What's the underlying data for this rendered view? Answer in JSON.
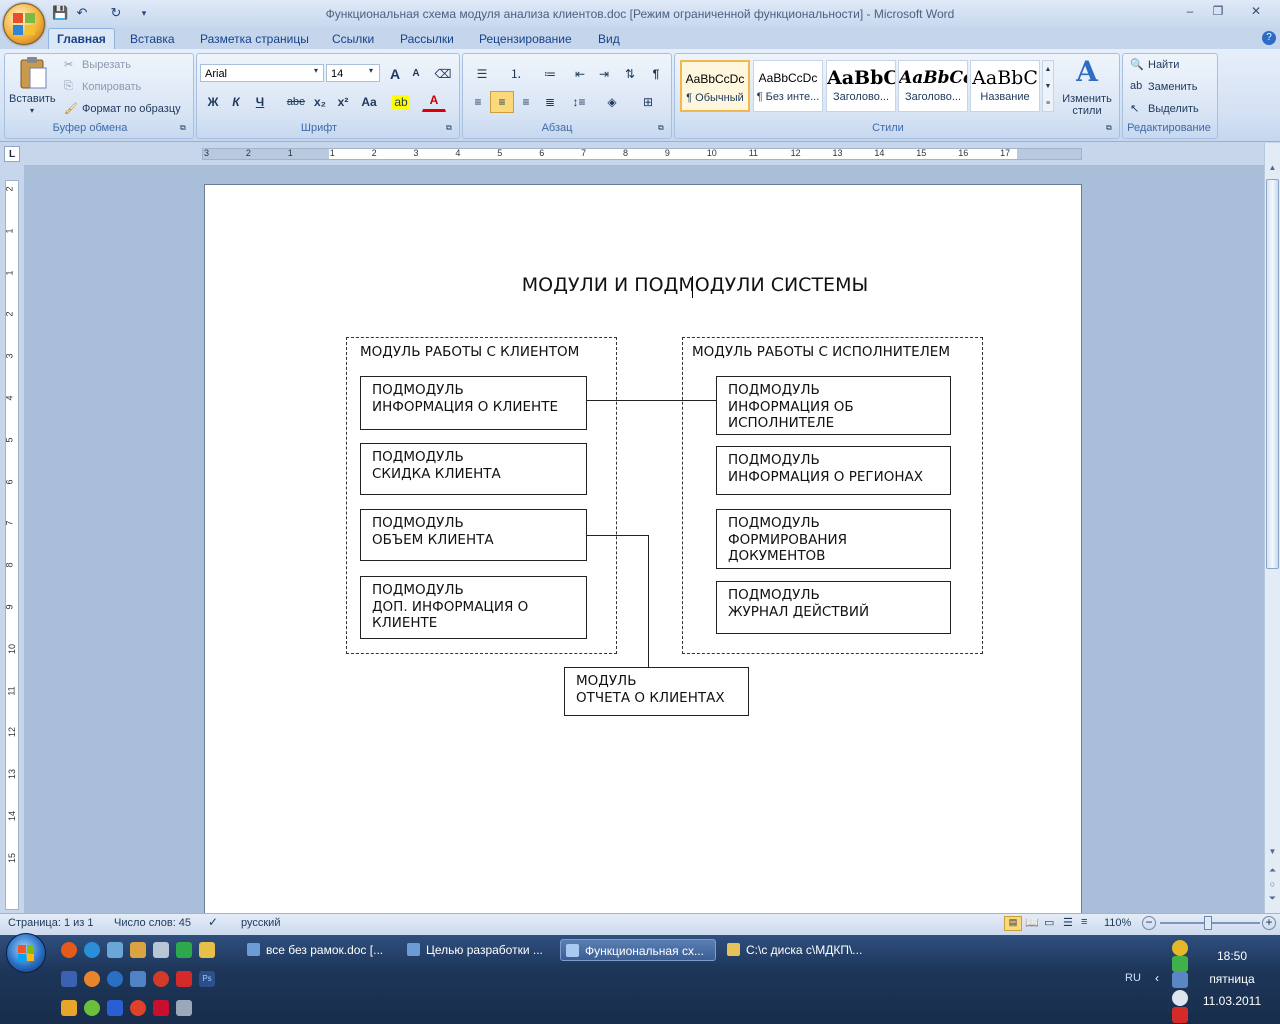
{
  "window": {
    "title": "Функциональная схема модуля анализа клиентов.doc [Режим ограниченной функциональности] - Microsoft Word",
    "controls": [
      "–",
      "❐",
      "✕"
    ]
  },
  "tabs": [
    "Главная",
    "Вставка",
    "Разметка страницы",
    "Ссылки",
    "Рассылки",
    "Рецензирование",
    "Вид"
  ],
  "ribbon": {
    "clipboard": {
      "paste": "Вставить",
      "cut": "Вырезать",
      "copy": "Копировать",
      "format_painter": "Формат по образцу",
      "label": "Буфер обмена"
    },
    "font": {
      "name": "Arial",
      "size": "14",
      "label": "Шрифт",
      "bold": "Ж",
      "italic": "К",
      "underline": "Ч",
      "strike": "abe",
      "sub": "x₂",
      "sup": "x²",
      "case": "Aa",
      "grow": "A",
      "shrink": "A",
      "color_letter": "A"
    },
    "paragraph": {
      "label": "Абзац",
      "pilcrow": "¶"
    },
    "styles": {
      "label": "Стили",
      "items": [
        {
          "preview": "AaBbCcDc",
          "name": "¶ Обычный"
        },
        {
          "preview": "AaBbCcDc",
          "name": "¶ Без инте..."
        },
        {
          "preview": "AaBbC",
          "name": "Заголово..."
        },
        {
          "preview": "AaBbCc",
          "name": "Заголово..."
        },
        {
          "preview": "AaBbC",
          "name": "Название"
        }
      ],
      "change_styles": "Изменить стили"
    },
    "editing": {
      "label": "Редактирование",
      "find": "Найти",
      "replace": "Заменить",
      "select": "Выделить"
    }
  },
  "ruler_numbers": [
    "3",
    "2",
    "1",
    "1",
    "2",
    "3",
    "4",
    "5",
    "6",
    "7",
    "8",
    "9",
    "10",
    "11",
    "12",
    "13",
    "14",
    "15",
    "16",
    "17"
  ],
  "vruler_numbers": [
    "2",
    "1",
    "1",
    "2",
    "3",
    "4",
    "5",
    "6",
    "7",
    "8",
    "9",
    "10",
    "11",
    "12",
    "13",
    "14",
    "15"
  ],
  "document": {
    "heading": "МОДУЛИ И ПОДМОДУЛИ СИСТЕМЫ",
    "client_module": {
      "title": "МОДУЛЬ РАБОТЫ С КЛИЕНТОМ",
      "submodules": [
        "ПОДМОДУЛЬ\nИНФОРМАЦИЯ О КЛИЕНТЕ",
        "ПОДМОДУЛЬ\nСКИДКА КЛИЕНТА",
        "ПОДМОДУЛЬ\nОБЪЕМ КЛИЕНТА",
        "ПОДМОДУЛЬ\nДОП. ИНФОРМАЦИЯ О\nКЛИЕНТЕ"
      ]
    },
    "executor_module": {
      "title": "МОДУЛЬ РАБОТЫ С ИСПОЛНИТЕЛЕМ",
      "submodules": [
        "ПОДМОДУЛЬ\nИНФОРМАЦИЯ ОБ\nИСПОЛНИТЕЛЕ",
        "ПОДМОДУЛЬ\nИНФОРМАЦИЯ О РЕГИОНАХ",
        "ПОДМОДУЛЬ\nФОРМИРОВАНИЯ\nДОКУМЕНТОВ",
        "ПОДМОДУЛЬ\nЖУРНАЛ ДЕЙСТВИЙ"
      ]
    },
    "report_module": "МОДУЛЬ\nОТЧЕТА О КЛИЕНТАХ"
  },
  "statusbar": {
    "page": "Страница: 1 из 1",
    "words": "Число слов: 45",
    "language": "русский",
    "zoom": "110%"
  },
  "taskbar": {
    "items": [
      {
        "label": "все без рамок.doc [...",
        "active": false
      },
      {
        "label": "Целью разработки ...",
        "active": false
      },
      {
        "label": "Функциональная сх...",
        "active": true
      },
      {
        "label": "C:\\с диска с\\МДКП\\...",
        "active": false
      }
    ],
    "lang": "RU",
    "time": "18:50",
    "day": "пятница",
    "date": "11.03.2011"
  },
  "colors": {
    "accent": "#15428b",
    "ribbon_bg": "#d3e1f3",
    "taskbar_bg": "#1d3659"
  }
}
